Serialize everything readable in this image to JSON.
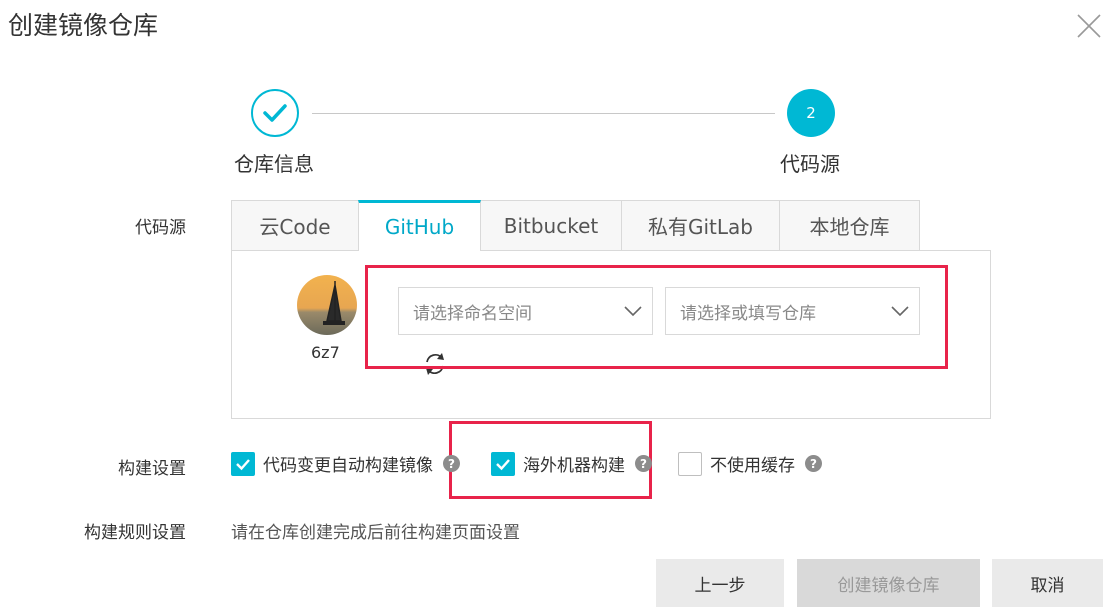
{
  "dialog": {
    "title": "创建镜像仓库"
  },
  "stepper": {
    "steps": [
      {
        "label": "仓库信息",
        "status": "done"
      },
      {
        "label": "代码源",
        "number": "2",
        "status": "active"
      }
    ]
  },
  "code_source": {
    "label": "代码源",
    "tabs": [
      "云Code",
      "GitHub",
      "Bitbucket",
      "私有GitLab",
      "本地仓库"
    ],
    "active_tab": "GitHub",
    "account": {
      "name": "6z7"
    },
    "namespace_select": {
      "placeholder": "请选择命名空间"
    },
    "repo_select": {
      "placeholder": "请选择或填写仓库"
    }
  },
  "build_settings": {
    "label": "构建设置",
    "options": [
      {
        "label": "代码变更自动构建镜像",
        "checked": true
      },
      {
        "label": "海外机器构建",
        "checked": true
      },
      {
        "label": "不使用缓存",
        "checked": false
      }
    ],
    "help_glyph": "?"
  },
  "build_rules": {
    "label": "构建规则设置",
    "text": "请在仓库创建完成后前往构建页面设置"
  },
  "buttons": {
    "prev": "上一步",
    "create": "创建镜像仓库",
    "cancel": "取消"
  },
  "colors": {
    "accent": "#00b8d4",
    "highlight": "#e8234a"
  }
}
